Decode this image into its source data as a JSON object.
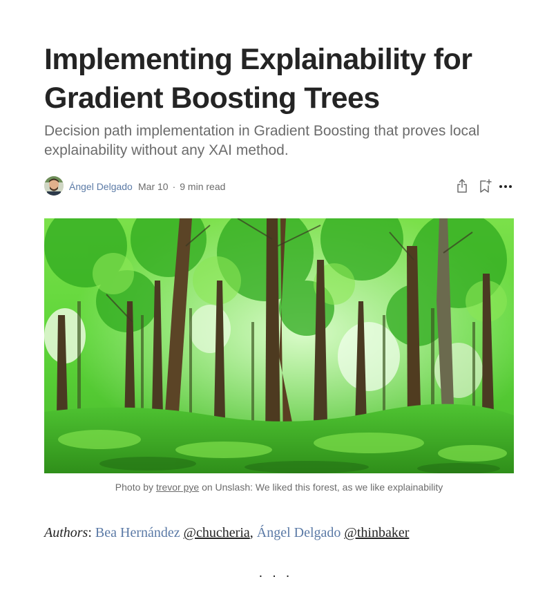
{
  "article": {
    "title": "Implementing Explainability for Gradient Boosting Trees",
    "subtitle": "Decision path implementation in Gradient Boosting that proves local explainability without any XAI method."
  },
  "byline": {
    "author": "Ángel Delgado",
    "date": "Mar 10",
    "separator": "·",
    "read_time": "9 min read",
    "avatar_icon": "author-avatar",
    "action_icons": [
      "share-icon",
      "bookmark-add-icon",
      "more-options-icon"
    ]
  },
  "hero": {
    "image_icon": "forest-photo",
    "caption_prefix": "Photo by ",
    "caption_link": "trevor pye",
    "caption_suffix": " on Unslash: We liked this forest, as we like explainability"
  },
  "authors_line": {
    "label": "Authors",
    "colon": ": ",
    "author1": "Bea Hernández",
    "handle1": "@chucheria",
    "comma": ", ",
    "author2": "Ángel Delgado",
    "handle2": "@thinbaker"
  },
  "section_break": "...",
  "colors": {
    "text": "#242424",
    "muted": "#6b6b6b",
    "link_blue": "#5b7aa6",
    "forest_green": "#3dbf1e"
  }
}
